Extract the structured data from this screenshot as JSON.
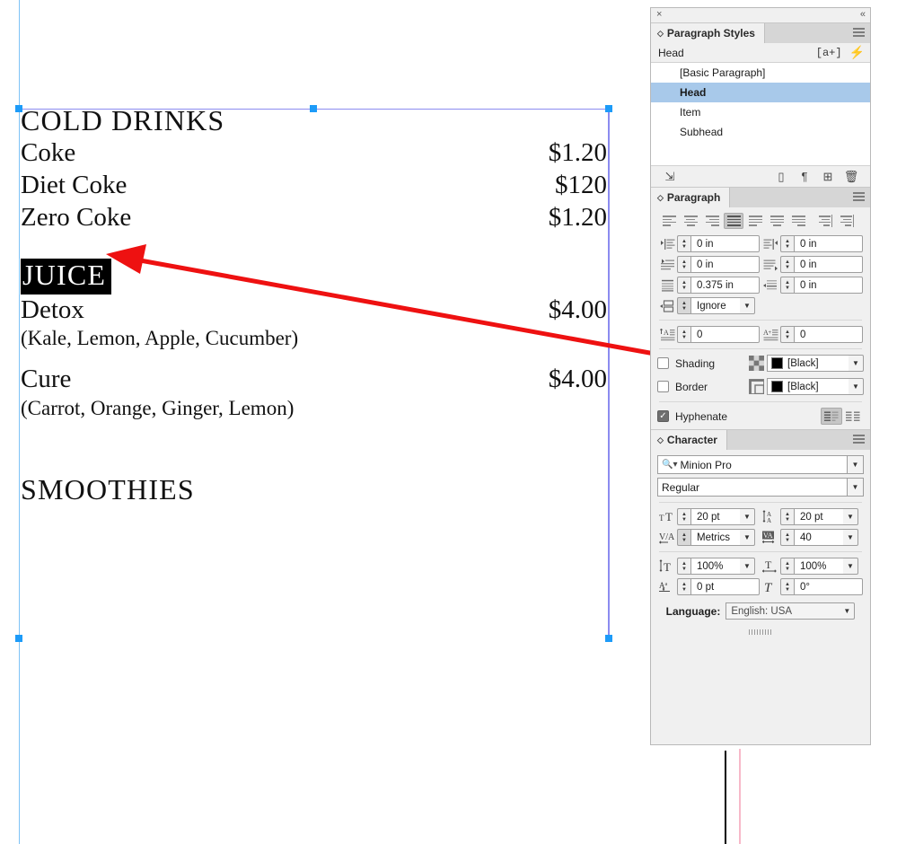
{
  "document": {
    "lines": [
      {
        "type": "head",
        "text": "COLD DRINKS",
        "price": ""
      },
      {
        "type": "item",
        "text": "Coke",
        "price": "$1.20"
      },
      {
        "type": "item",
        "text": "Diet Coke",
        "price": "$120"
      },
      {
        "type": "item",
        "text": "Zero Coke",
        "price": "$1.20"
      },
      {
        "type": "head-selected",
        "text": "JUICE",
        "price": ""
      },
      {
        "type": "item",
        "text": "Detox",
        "price": "$4.00"
      },
      {
        "type": "sub",
        "text": "(Kale, Lemon, Apple, Cucumber)",
        "price": ""
      },
      {
        "type": "item",
        "text": "Cure",
        "price": "$4.00"
      },
      {
        "type": "sub",
        "text": "(Carrot, Orange, Ginger, Lemon)",
        "price": ""
      },
      {
        "type": "head",
        "text": "SMOOTHIES",
        "price": ""
      }
    ]
  },
  "dock": {
    "close_glyph": "×",
    "collapse_glyph": "«"
  },
  "paragraph_styles": {
    "tab_label": "Paragraph Styles",
    "current_style": "Head",
    "override_badge": "[a+]",
    "bolt_glyph": "⚡",
    "items": [
      {
        "label": "[Basic Paragraph]",
        "selected": false
      },
      {
        "label": "Head",
        "selected": true
      },
      {
        "label": "Item",
        "selected": false
      },
      {
        "label": "Subhead",
        "selected": false
      }
    ],
    "footer_icons": [
      "load-styles-icon",
      "new-style-group-icon",
      "clear-overrides-icon",
      "create-new-style-icon",
      "delete-style-icon"
    ]
  },
  "paragraph_panel": {
    "tab_label": "Paragraph",
    "alignment": {
      "options": [
        "align-left",
        "align-center",
        "align-right",
        "justify-all-lines",
        "justify-last-left",
        "justify-last-center",
        "justify-last-right",
        "align-toward-spine",
        "align-away-spine"
      ],
      "active_index": 3
    },
    "fields": [
      {
        "name": "left-indent",
        "icon": "left-indent-icon",
        "value": "0 in"
      },
      {
        "name": "right-indent",
        "icon": "right-indent-icon",
        "value": "0 in"
      },
      {
        "name": "first-line-indent",
        "icon": "first-line-indent-icon",
        "value": "0 in"
      },
      {
        "name": "last-line-indent",
        "icon": "last-line-indent-icon",
        "value": "0 in"
      },
      {
        "name": "space-before",
        "icon": "space-before-icon",
        "value": "0.375 in"
      },
      {
        "name": "space-after",
        "icon": "space-after-icon",
        "value": "0 in"
      },
      {
        "name": "space-between-same",
        "icon": "space-between-same-icon",
        "value": "Ignore"
      },
      {
        "name": "drop-cap-lines",
        "icon": "drop-cap-lines-icon",
        "value": "0"
      },
      {
        "name": "drop-cap-chars",
        "icon": "drop-cap-chars-icon",
        "value": "0"
      }
    ],
    "shading": {
      "label": "Shading",
      "checked": false,
      "color": "[Black]",
      "swatch_hex": "#000000"
    },
    "border": {
      "label": "Border",
      "checked": false,
      "color": "[Black]",
      "swatch_hex": "#000000"
    },
    "hyphenate": {
      "label": "Hyphenate",
      "checked": true
    },
    "composer": {
      "options": [
        "paragraph-composer",
        "single-line-composer"
      ],
      "active_index": 0
    }
  },
  "character_panel": {
    "tab_label": "Character",
    "font_family": "Minion Pro",
    "font_style": "Regular",
    "font_size": "20 pt",
    "leading": "20 pt",
    "kerning": "Metrics",
    "tracking": "40",
    "vertical_scale": "100%",
    "horizontal_scale": "100%",
    "baseline_shift": "0 pt",
    "skew": "0°",
    "language_label": "Language:",
    "language": "English: USA"
  },
  "colors": {
    "selection_handle": "#1d9bf8",
    "frame_guide_blue": "#7ec3f7",
    "frame_guide_purple": "#8b8bf0",
    "annotation_red": "#ee1111",
    "style_row_selected": "#a8c9ea",
    "margin_guide_pink": "#f7b9c9"
  }
}
